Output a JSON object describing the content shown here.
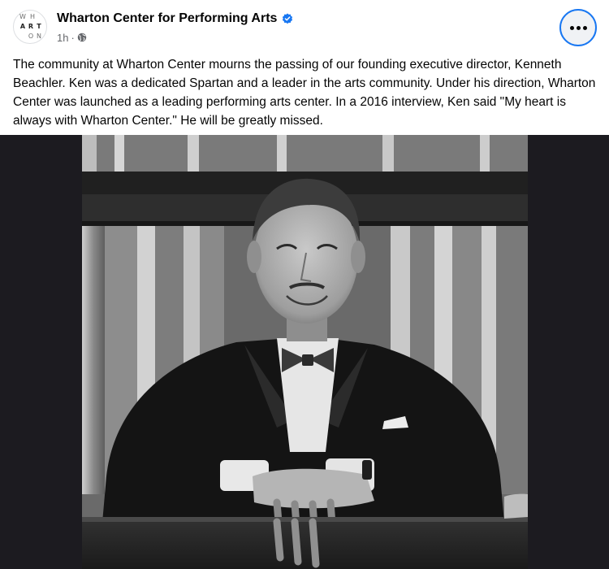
{
  "post": {
    "page_name": "Wharton Center for Performing Arts",
    "timestamp": "1h",
    "separator": "·",
    "audience_icon": "globe-icon",
    "verified_icon": "verified-badge-icon",
    "more_icon": "more-options-icon",
    "avatar_logo": {
      "letters": [
        "W",
        "H",
        "A",
        "R",
        "T",
        "O",
        "N"
      ]
    },
    "text": "The community at Wharton Center mourns the passing of our founding executive director, Kenneth Beachler. Ken was a dedicated Spartan and a leader in the arts community. Under his direction, Wharton Center was launched as a leading performing arts center. In a 2016 interview, Ken said \"My heart is always with Wharton Center.\" He will be greatly missed.",
    "photo": {
      "style": "black-and-white vintage photograph",
      "subject": "man in tuxedo and bow tie seated in theater box"
    }
  },
  "colors": {
    "accent": "#1877f2",
    "text_primary": "#050505",
    "text_secondary": "#65676b",
    "media_background": "#1c1b20"
  }
}
